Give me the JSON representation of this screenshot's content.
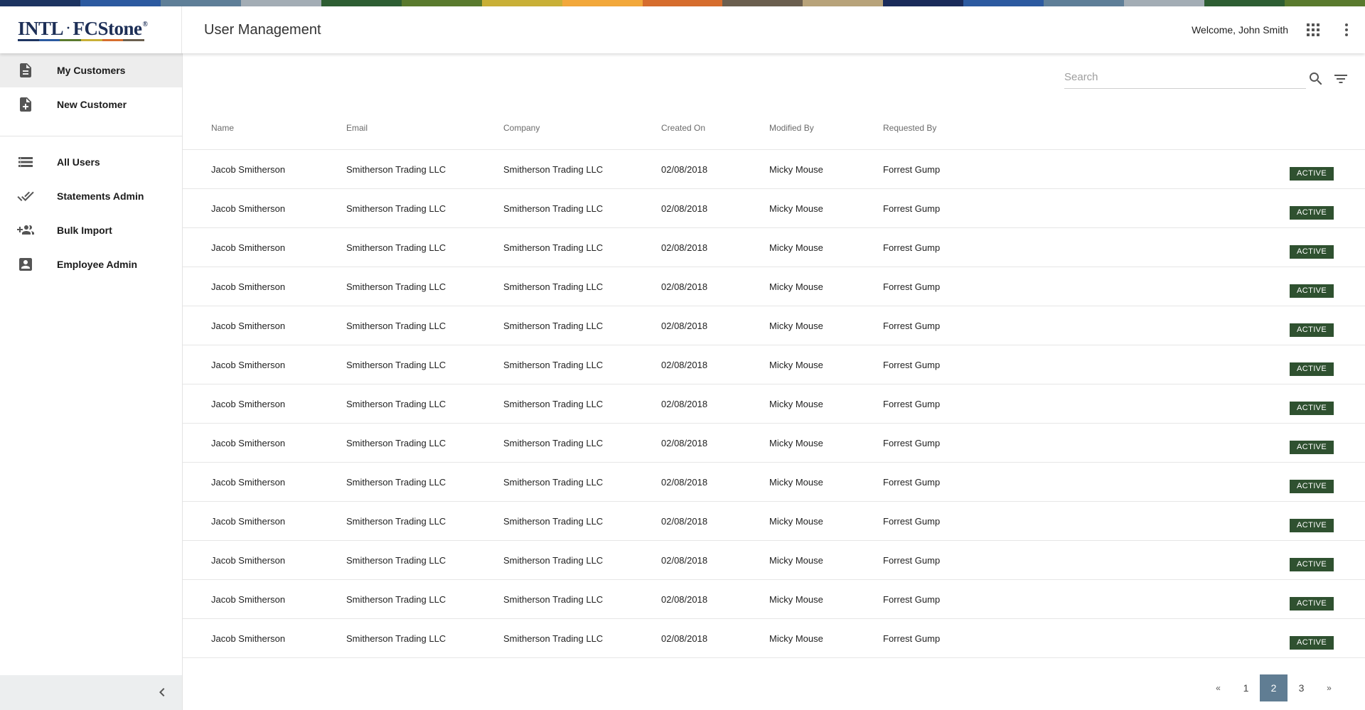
{
  "colors": {
    "stripe": [
      "#1d3461",
      "#2c5aa0",
      "#5f7f98",
      "#a3adb5",
      "#2e5e33",
      "#5a7a2e",
      "#c9b037",
      "#f2a83b",
      "#d66d2e",
      "#6b5f4f",
      "#b8a37a",
      "#1a2b5a",
      "#2c5aa0",
      "#5f7f98",
      "#a3adb5",
      "#2e5e33",
      "#5a7a2e"
    ],
    "logo_underline": [
      "#1d3461",
      "#2c5aa0",
      "#5a7a2e",
      "#c9b037",
      "#d66d2e",
      "#6b5f4f"
    ],
    "status_active": "#2f5130",
    "page_current": "#607d93"
  },
  "header": {
    "logo_left": "INTL",
    "logo_separator": "·",
    "logo_right": "FCStone",
    "logo_mark": "®",
    "title": "User Management",
    "welcome": "Welcome, John Smith",
    "apps_icon": "apps-grid-icon",
    "menu_icon": "more-vert-icon"
  },
  "sidebar": {
    "items": [
      {
        "label": "My Customers",
        "icon": "document-icon",
        "active": true
      },
      {
        "label": "New Customer",
        "icon": "add-document-icon",
        "active": false
      },
      {
        "label": "All Users",
        "icon": "list-icon",
        "active": false
      },
      {
        "label": "Statements Admin",
        "icon": "double-check-icon",
        "active": false
      },
      {
        "label": "Bulk Import",
        "icon": "group-add-icon",
        "active": false
      },
      {
        "label": "Employee Admin",
        "icon": "account-box-icon",
        "active": false
      }
    ],
    "collapse_icon": "chevron-left-icon"
  },
  "search": {
    "placeholder": "Search",
    "value": ""
  },
  "table": {
    "columns": [
      "Name",
      "Email",
      "Company",
      "Created On",
      "Modified By",
      "Requested By"
    ],
    "rows": [
      {
        "name": "Jacob Smitherson",
        "email": "Smitherson Trading LLC",
        "company": "Smitherson Trading LLC",
        "created": "02/08/2018",
        "modified_by": "Micky Mouse",
        "requested_by": "Forrest Gump",
        "status": "ACTIVE"
      },
      {
        "name": "Jacob Smitherson",
        "email": "Smitherson Trading LLC",
        "company": "Smitherson Trading LLC",
        "created": "02/08/2018",
        "modified_by": "Micky Mouse",
        "requested_by": "Forrest Gump",
        "status": "ACTIVE"
      },
      {
        "name": "Jacob Smitherson",
        "email": "Smitherson Trading LLC",
        "company": "Smitherson Trading LLC",
        "created": "02/08/2018",
        "modified_by": "Micky Mouse",
        "requested_by": "Forrest Gump",
        "status": "ACTIVE"
      },
      {
        "name": "Jacob Smitherson",
        "email": "Smitherson Trading LLC",
        "company": "Smitherson Trading LLC",
        "created": "02/08/2018",
        "modified_by": "Micky Mouse",
        "requested_by": "Forrest Gump",
        "status": "ACTIVE"
      },
      {
        "name": "Jacob Smitherson",
        "email": "Smitherson Trading LLC",
        "company": "Smitherson Trading LLC",
        "created": "02/08/2018",
        "modified_by": "Micky Mouse",
        "requested_by": "Forrest Gump",
        "status": "ACTIVE"
      },
      {
        "name": "Jacob Smitherson",
        "email": "Smitherson Trading LLC",
        "company": "Smitherson Trading LLC",
        "created": "02/08/2018",
        "modified_by": "Micky Mouse",
        "requested_by": "Forrest Gump",
        "status": "ACTIVE"
      },
      {
        "name": "Jacob Smitherson",
        "email": "Smitherson Trading LLC",
        "company": "Smitherson Trading LLC",
        "created": "02/08/2018",
        "modified_by": "Micky Mouse",
        "requested_by": "Forrest Gump",
        "status": "ACTIVE"
      },
      {
        "name": "Jacob Smitherson",
        "email": "Smitherson Trading LLC",
        "company": "Smitherson Trading LLC",
        "created": "02/08/2018",
        "modified_by": "Micky Mouse",
        "requested_by": "Forrest Gump",
        "status": "ACTIVE"
      },
      {
        "name": "Jacob Smitherson",
        "email": "Smitherson Trading LLC",
        "company": "Smitherson Trading LLC",
        "created": "02/08/2018",
        "modified_by": "Micky Mouse",
        "requested_by": "Forrest Gump",
        "status": "ACTIVE"
      },
      {
        "name": "Jacob Smitherson",
        "email": "Smitherson Trading LLC",
        "company": "Smitherson Trading LLC",
        "created": "02/08/2018",
        "modified_by": "Micky Mouse",
        "requested_by": "Forrest Gump",
        "status": "ACTIVE"
      },
      {
        "name": "Jacob Smitherson",
        "email": "Smitherson Trading LLC",
        "company": "Smitherson Trading LLC",
        "created": "02/08/2018",
        "modified_by": "Micky Mouse",
        "requested_by": "Forrest Gump",
        "status": "ACTIVE"
      },
      {
        "name": "Jacob Smitherson",
        "email": "Smitherson Trading LLC",
        "company": "Smitherson Trading LLC",
        "created": "02/08/2018",
        "modified_by": "Micky Mouse",
        "requested_by": "Forrest Gump",
        "status": "ACTIVE"
      },
      {
        "name": "Jacob Smitherson",
        "email": "Smitherson Trading LLC",
        "company": "Smitherson Trading LLC",
        "created": "02/08/2018",
        "modified_by": "Micky Mouse",
        "requested_by": "Forrest Gump",
        "status": "ACTIVE"
      }
    ]
  },
  "pagination": {
    "prev": "«",
    "next": "»",
    "pages": [
      "1",
      "2",
      "3"
    ],
    "current": "2"
  }
}
